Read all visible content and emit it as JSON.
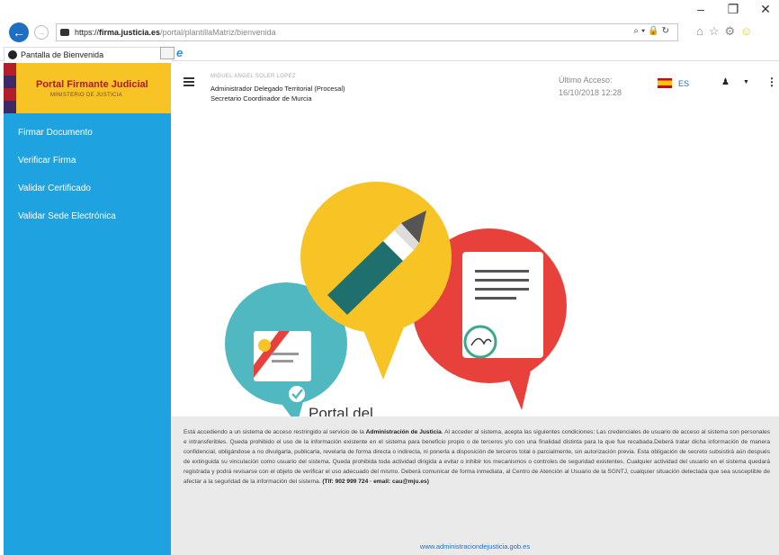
{
  "browser": {
    "url_scheme": "https://",
    "url_host": "firma.justicia.es",
    "url_path": "/portal/plantillaMatriz/bienvenida",
    "tab_title": "Pantalla de Bienvenida",
    "window_controls": [
      "–",
      "❐",
      "✕"
    ]
  },
  "sidebar": {
    "brand_title": "Portal Firmante Judicial",
    "brand_subtitle": "MINISTERIO DE JUSTICIA",
    "items": [
      {
        "label": "Firmar Documento"
      },
      {
        "label": "Verificar Firma"
      },
      {
        "label": "Validar Certificado"
      },
      {
        "label": "Validar Sede Electrónica"
      }
    ]
  },
  "header": {
    "user_name": "MIGUEL ANGEL SOLER LOPEZ",
    "role_1": "Administrador Delegado Territorial (Procesal)",
    "role_2": "Secretario Coordinador de Murcia",
    "last_access_label": "Último Acceso:",
    "last_access_date": "16/10/2018 12:28",
    "language": "ES"
  },
  "hero": {
    "caption": "Portal del",
    "colors": {
      "yellow": "#f7c325",
      "red": "#e8413c",
      "teal": "#4fb8c1"
    }
  },
  "footer": {
    "disclaimer_pre": "Está accediendo a un sistema de acceso restringido al servicio de la ",
    "disclaimer_org": "Administración de Justicia",
    "disclaimer_body": ". Al acceder al sistema, acepta las siguientes condiciones: Las credenciales de usuario de acceso al sistema son personales e intransferibles. Queda prohibido el uso de la información existente en el sistema para beneficio propio o de terceros y/o con una finalidad distinta para la que fue recabada.Deberá tratar dicha información de manera confidencial, obligándose a no divulgarla, publicarla, revelarla de forma directa o indirecta, ni ponerla a disposición de terceros total o parcialmente, sin autorización previa. Esta obligación de secreto subsistirá aún después de extinguida su vinculación como usuario del sistema. Queda prohibida toda actividad dirigida a evitar o inhibir los mecanismos o controles de seguridad existentes. Cualquier actividad del usuario en el sistema quedará registrada y podrá revisarse con el objeto de verificar el uso adecuado del mismo. Deberá comunicar de forma inmediata, al Centro de Atención al Usuario de la SGNTJ, cualquier situación detectada que sea susceptible de afectar a la seguridad de la información del sistema. ",
    "disclaimer_contact": "(Tlf: 902 999 724 · email: cau@mju.es)",
    "link": "www.administraciondejusticia.gob.es"
  },
  "accent_color": "#1fa2e0"
}
